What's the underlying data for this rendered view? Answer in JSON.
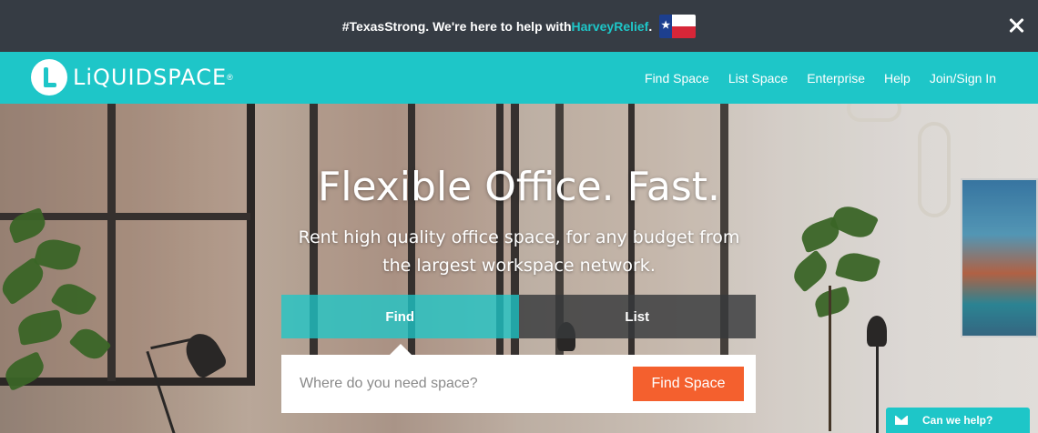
{
  "announcement": {
    "text_before": "#TexasStrong. We're here to help with ",
    "link": "HarveyRelief",
    "text_after": ".",
    "link_color": "#1ec6c8",
    "flag_icon": "texas-flag-icon",
    "close_icon": "close-icon"
  },
  "header": {
    "brand": "LiQUIDSPACE",
    "brand_mark": "®",
    "logo_icon": "liquidspace-logo-icon",
    "nav": [
      {
        "label": "Find Space"
      },
      {
        "label": "List Space"
      },
      {
        "label": "Enterprise"
      },
      {
        "label": "Help"
      },
      {
        "label": "Join/Sign In"
      }
    ],
    "accent_color": "#1ec6c8"
  },
  "hero": {
    "headline": "Flexible Office. Fast.",
    "subheadline": "Rent high quality office space, for any budget from the largest workspace network.",
    "tabs": [
      {
        "label": "Find",
        "active": true
      },
      {
        "label": "List",
        "active": false
      }
    ],
    "search": {
      "value": "",
      "placeholder": "Where do you need space?",
      "button_label": "Find Space",
      "button_color": "#f4602e"
    }
  },
  "chat": {
    "label": "Can we help?",
    "icon": "envelope-icon"
  }
}
